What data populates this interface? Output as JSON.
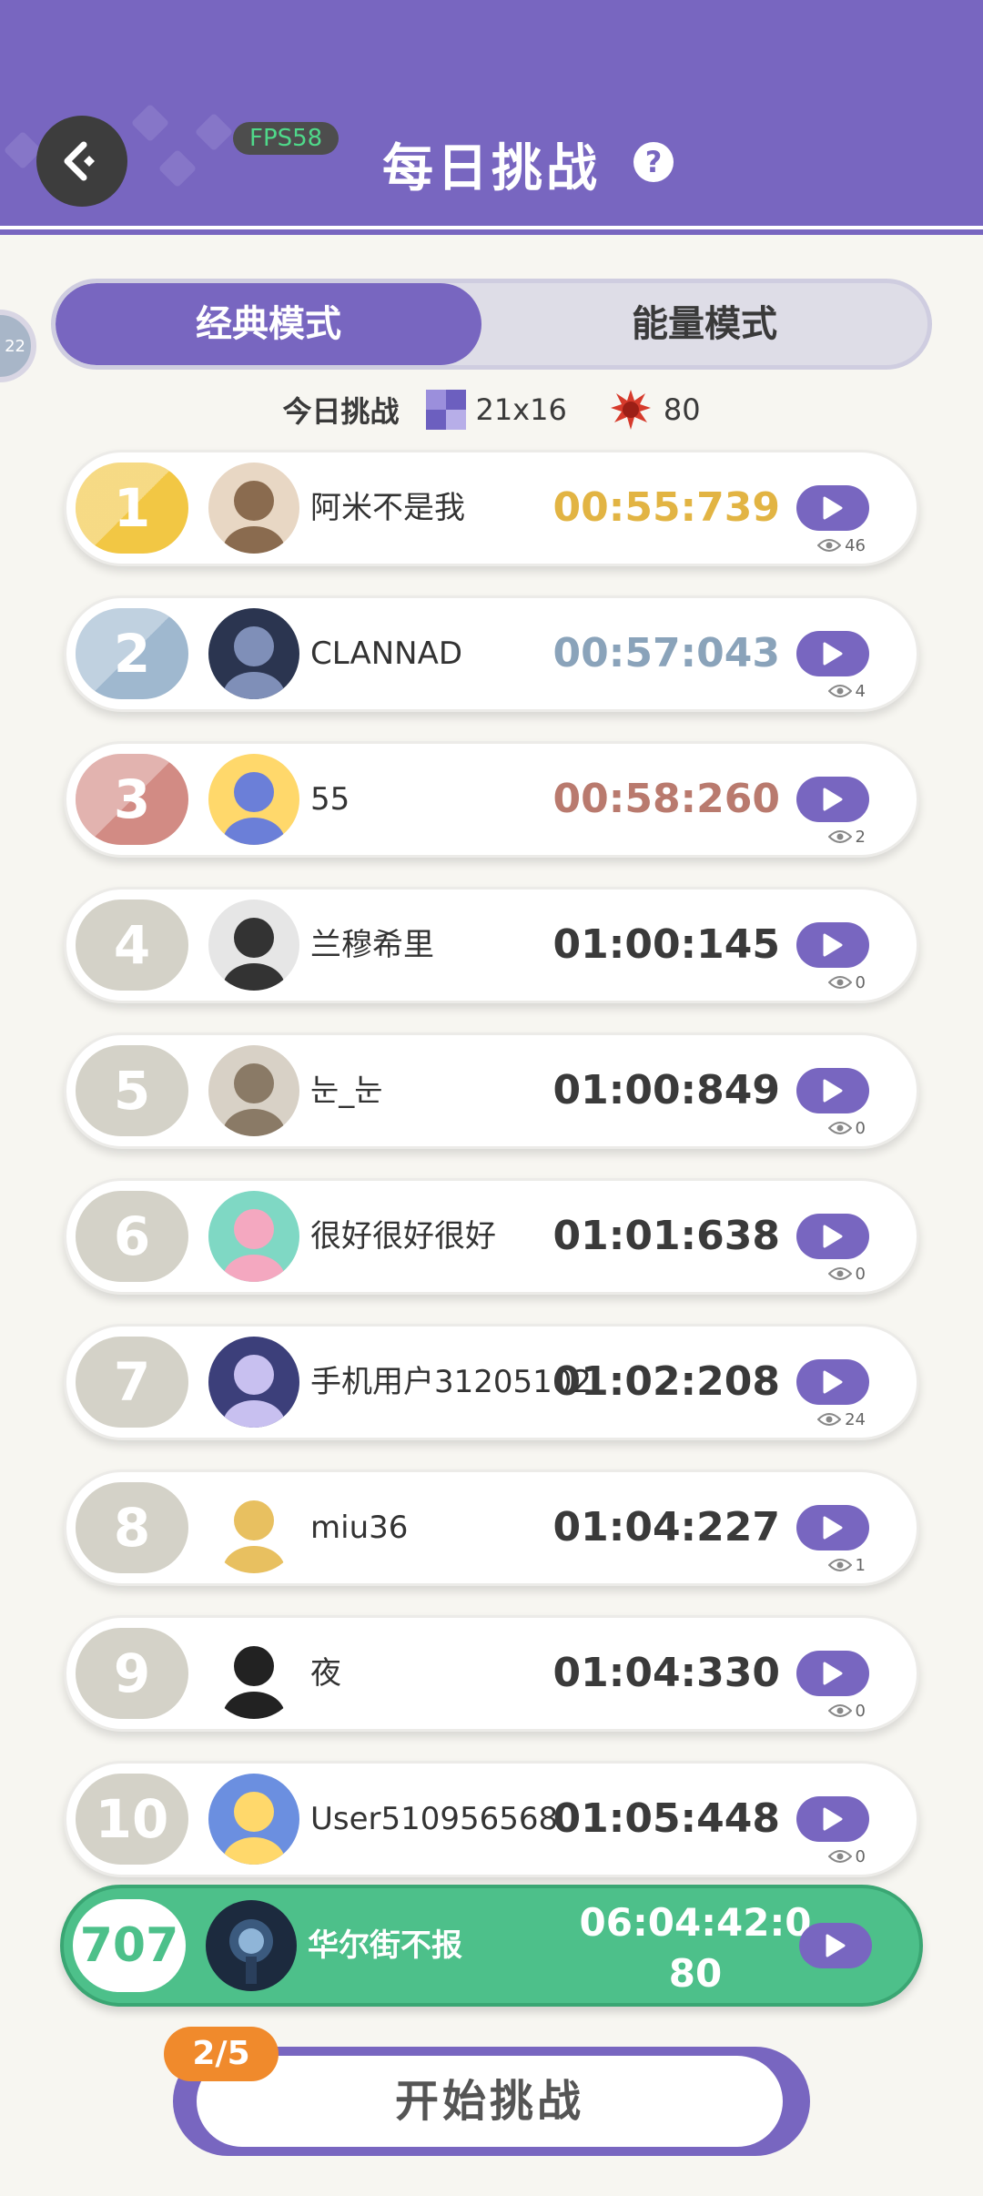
{
  "header": {
    "fps_label": "FPS58",
    "title": "每日挑战",
    "help_glyph": "?",
    "back_icon": "back-arrow-icon",
    "background_color": "#7866c0"
  },
  "side_fragment": "22",
  "tabs": [
    {
      "label": "经典模式",
      "active": true
    },
    {
      "label": "能量模式",
      "active": false
    }
  ],
  "today": {
    "label": "今日挑战",
    "board_size": "21x16",
    "energy": "80"
  },
  "leaderboard": [
    {
      "rank": "1",
      "name": "阿米不是我",
      "time": "00:55:739",
      "views": "46",
      "badge_color": "#f2c744",
      "time_color": "#e2b443"
    },
    {
      "rank": "2",
      "name": "CLANNAD",
      "time": "00:57:043",
      "views": "4",
      "badge_color": "#9fb8cf",
      "time_color": "#8aa3ba"
    },
    {
      "rank": "3",
      "name": "55",
      "time": "00:58:260",
      "views": "2",
      "badge_color": "#d28b84",
      "time_color": "#b97a6e"
    },
    {
      "rank": "4",
      "name": "兰穆希里",
      "time": "01:00:145",
      "views": "0",
      "badge_color": "#d4d2c8",
      "time_color": "#3a3a3a"
    },
    {
      "rank": "5",
      "name": "눈_눈",
      "time": "01:00:849",
      "views": "0",
      "badge_color": "#d4d2c8",
      "time_color": "#3a3a3a"
    },
    {
      "rank": "6",
      "name": "很好很好很好",
      "time": "01:01:638",
      "views": "0",
      "badge_color": "#d4d2c8",
      "time_color": "#3a3a3a"
    },
    {
      "rank": "7",
      "name": "手机用户31205102",
      "time": "01:02:208",
      "views": "24",
      "badge_color": "#d4d2c8",
      "time_color": "#3a3a3a"
    },
    {
      "rank": "8",
      "name": "miu36",
      "time": "01:04:227",
      "views": "1",
      "badge_color": "#d4d2c8",
      "time_color": "#3a3a3a"
    },
    {
      "rank": "9",
      "name": "夜",
      "time": "01:04:330",
      "views": "0",
      "badge_color": "#d4d2c8",
      "time_color": "#3a3a3a"
    },
    {
      "rank": "10",
      "name": "User510956568",
      "time": "01:05:448",
      "views": "0",
      "badge_color": "#d4d2c8",
      "time_color": "#3a3a3a"
    }
  ],
  "self": {
    "rank": "707",
    "name": "华尔街不报",
    "time_line1": "06:04:42:0",
    "time_line2": "80",
    "row_color": "#4dc08a"
  },
  "start": {
    "label": "开始挑战",
    "attempts": "2/5",
    "attempts_color": "#f08a2c"
  }
}
